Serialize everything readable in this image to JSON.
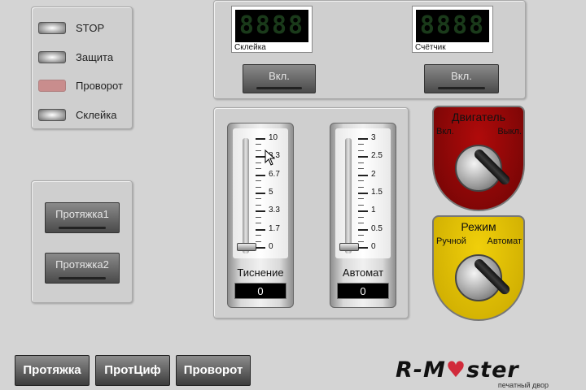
{
  "status_lamps": [
    {
      "label": "STOP",
      "state": "off"
    },
    {
      "label": "Защита",
      "state": "off"
    },
    {
      "label": "Проворот",
      "state": "alarm",
      "color": "#c98d8d"
    },
    {
      "label": "Склейка",
      "state": "off"
    }
  ],
  "counters": [
    {
      "label": "Склейка",
      "display": "8888",
      "button_label": "Вкл."
    },
    {
      "label": "Счётчик",
      "display": "8888",
      "button_label": "Вкл."
    }
  ],
  "pull_buttons": [
    {
      "label": "Протяжка1"
    },
    {
      "label": "Протяжка2"
    }
  ],
  "gauges": [
    {
      "name": "Тиснение",
      "value": "0",
      "scale_labels": [
        "10",
        "8.3",
        "6.7",
        "5",
        "3.3",
        "1.7",
        "0"
      ],
      "level": 0
    },
    {
      "name": "Автомат",
      "value": "0",
      "scale_labels": [
        "3",
        "2.5",
        "2",
        "1.5",
        "1",
        "0.5",
        "0"
      ],
      "level": 0
    }
  ],
  "engine_switch": {
    "title": "Двигатель",
    "left": "Вкл.",
    "right": "Выкл.",
    "color": "#b00a0a"
  },
  "mode_switch": {
    "title": "Режим",
    "left": "Ручной",
    "right": "Автомат",
    "color": "#f0cf0a"
  },
  "bottom_buttons": [
    {
      "label": "Протяжка"
    },
    {
      "label": "ПротЦиф"
    },
    {
      "label": "Проворот"
    }
  ],
  "logo": {
    "brand_left": "R-M",
    "brand_right": "ster",
    "subtitle": "печатный двор"
  },
  "cursor_icon": "arrow-cursor-icon"
}
